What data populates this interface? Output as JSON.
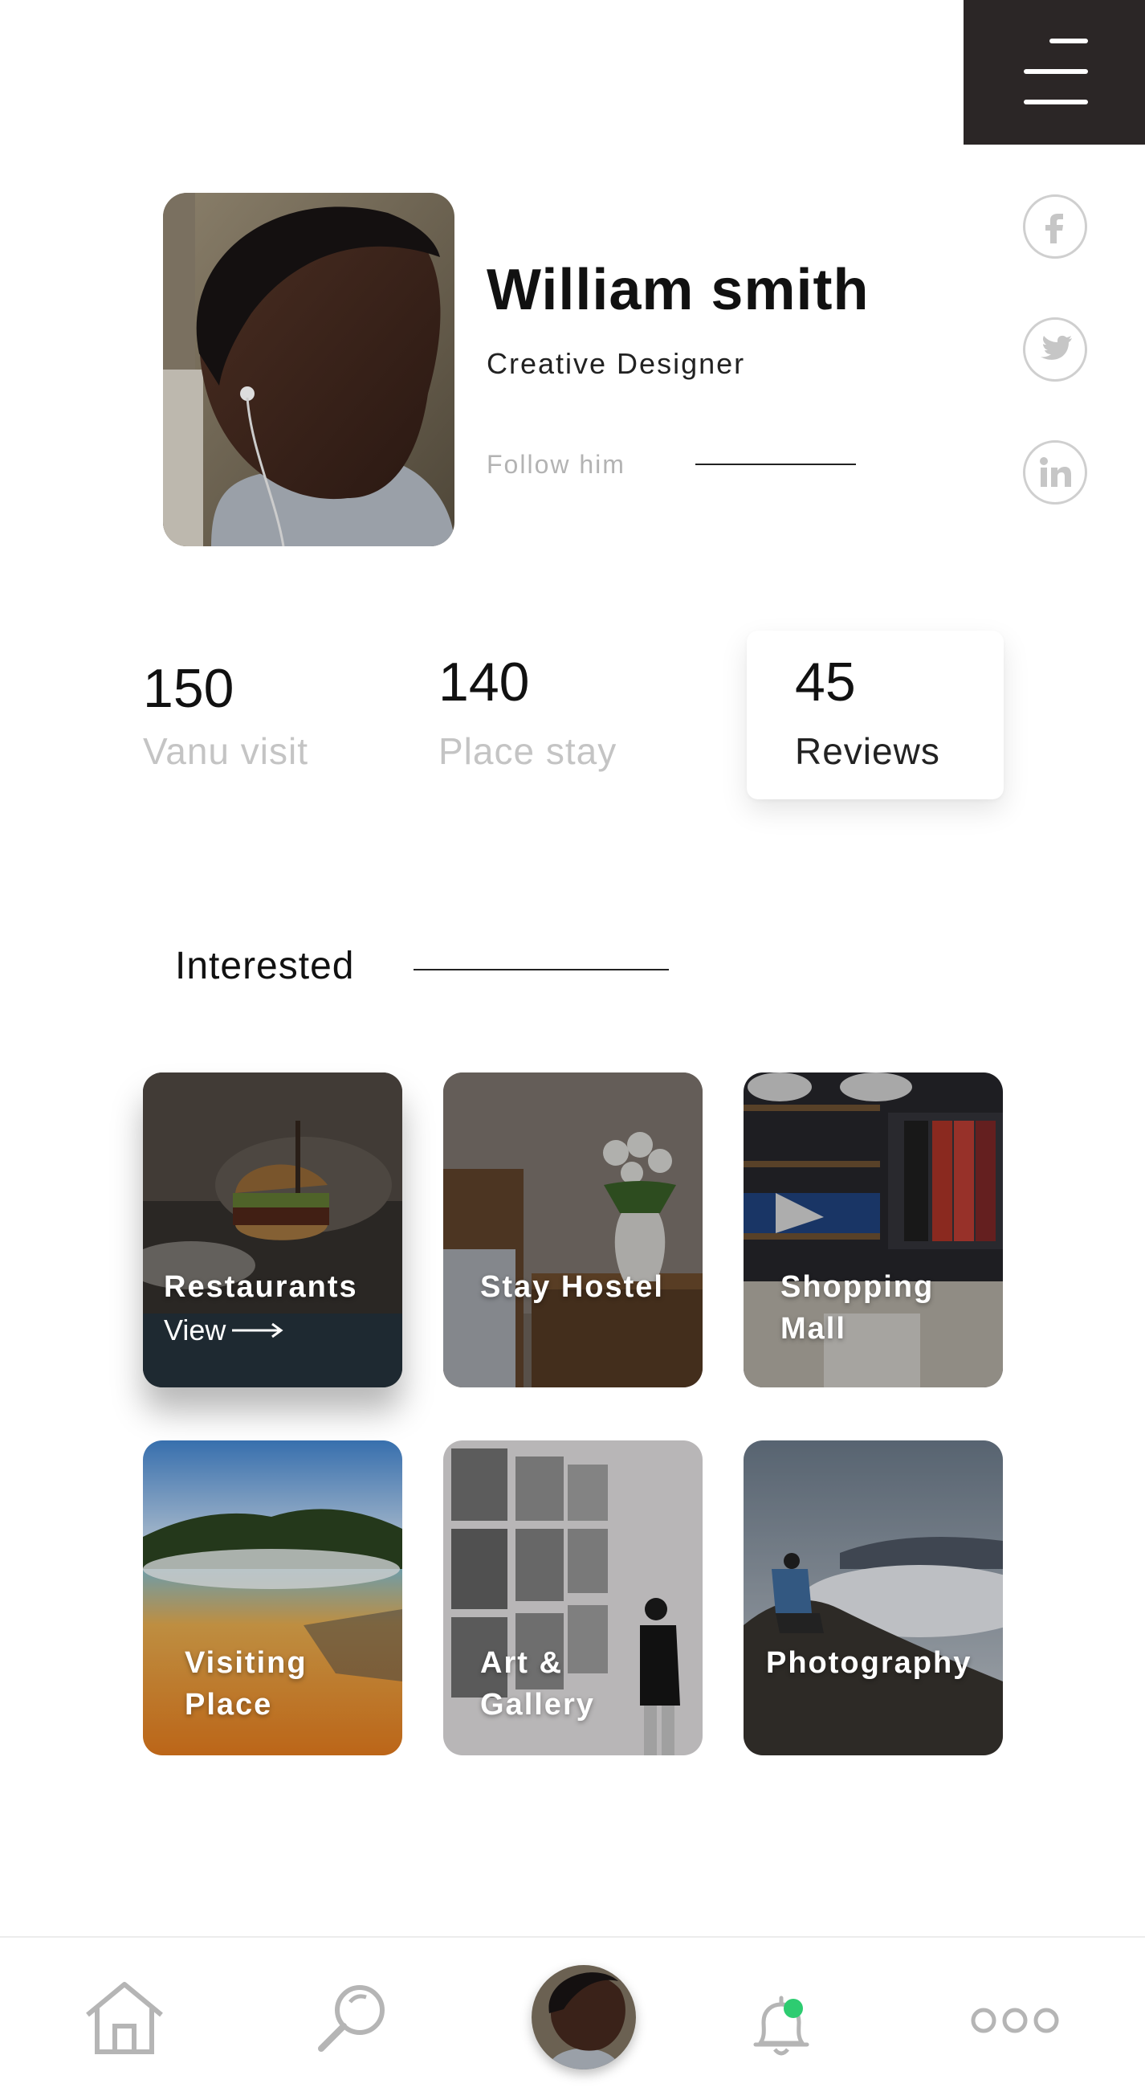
{
  "header": {
    "menu_icon": "hamburger-menu-icon"
  },
  "profile": {
    "name": "William smith",
    "role": "Creative Designer",
    "follow_label": "Follow him"
  },
  "social": [
    {
      "icon": "facebook-icon",
      "glyph": "f"
    },
    {
      "icon": "twitter-icon",
      "glyph": "bird"
    },
    {
      "icon": "linkedin-icon",
      "glyph": "in"
    }
  ],
  "stats": [
    {
      "value": "150",
      "label": "Vanu visit"
    },
    {
      "value": "140",
      "label": "Place stay"
    },
    {
      "value": "45",
      "label": "Reviews"
    }
  ],
  "section": {
    "title": "Interested"
  },
  "cards": [
    {
      "label_line1": "Restaurants",
      "label_line2": "",
      "link": "View",
      "active": true
    },
    {
      "label_line1": "Stay Hostel",
      "label_line2": ""
    },
    {
      "label_line1": "Shopping",
      "label_line2": "Mall"
    },
    {
      "label_line1": "Visiting",
      "label_line2": "Place"
    },
    {
      "label_line1": "Art &",
      "label_line2": "Gallery"
    },
    {
      "label_line1": "Photography",
      "label_line2": ""
    }
  ],
  "nav": {
    "items": [
      "home-icon",
      "search-icon",
      "profile-avatar",
      "bell-icon",
      "more-icon"
    ],
    "notification_color": "#2ecc71"
  },
  "colors": {
    "menu_bg": "#2b2626",
    "muted_text": "#c4c4c4",
    "icon_gray": "#c6c6c6"
  }
}
